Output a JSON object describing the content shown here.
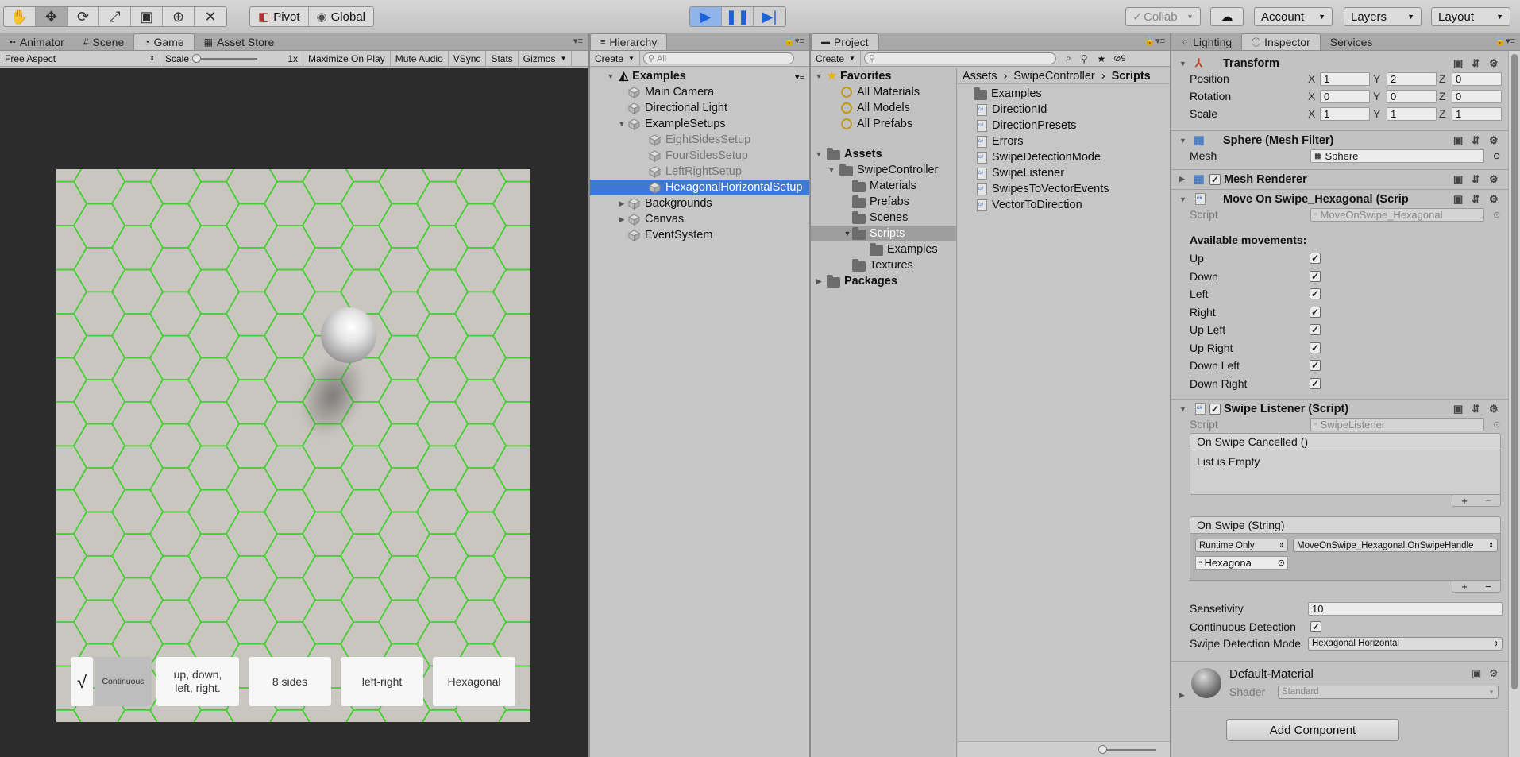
{
  "toolbar": {
    "tools": [
      "hand-tool",
      "move-tool",
      "rotate-tool",
      "scale-tool",
      "rect-tool",
      "transform-tool",
      "custom-tool"
    ],
    "pivot_label": "Pivot",
    "global_label": "Global",
    "collab_label": "Collab",
    "account_label": "Account",
    "layers_label": "Layers",
    "layout_label": "Layout"
  },
  "game_panel": {
    "tabs": [
      "Animator",
      "Scene",
      "Game",
      "Asset Store"
    ],
    "active_tab": "Game",
    "aspect": "Free Aspect",
    "scale_label": "Scale",
    "scale_value": "1x",
    "options": [
      "Maximize On Play",
      "Mute Audio",
      "VSync",
      "Stats",
      "Gizmos"
    ],
    "buttons": {
      "check": "√",
      "continuous": "Continuous",
      "up_down": "up, down,\nleft, right.",
      "eight": "8 sides",
      "left_right": "left-right",
      "hexagonal": "Hexagonal"
    }
  },
  "hierarchy": {
    "tab": "Hierarchy",
    "create_label": "Create",
    "search_placeholder": "All",
    "scene": "Examples",
    "items": [
      {
        "label": "Main Camera"
      },
      {
        "label": "Directional Light"
      },
      {
        "label": "ExampleSetups"
      },
      {
        "label": "EightSidesSetup"
      },
      {
        "label": "FourSidesSetup"
      },
      {
        "label": "LeftRightSetup"
      },
      {
        "label": "HexagonalHorizontalSetup"
      },
      {
        "label": "Backgrounds"
      },
      {
        "label": "Canvas"
      },
      {
        "label": "EventSystem"
      }
    ]
  },
  "project": {
    "tab": "Project",
    "create_label": "Create",
    "badge_count": "9",
    "favorites": "Favorites",
    "fav_items": [
      "All Materials",
      "All Models",
      "All Prefabs"
    ],
    "assets": "Assets",
    "tree": [
      "SwipeController",
      "Materials",
      "Prefabs",
      "Scenes",
      "Scripts",
      "Examples",
      "Textures"
    ],
    "packages": "Packages",
    "breadcrumb": [
      "Assets",
      "SwipeController",
      "Scripts"
    ],
    "files": [
      "Examples",
      "DirectionId",
      "DirectionPresets",
      "Errors",
      "SwipeDetectionMode",
      "SwipeListener",
      "SwipesToVectorEvents",
      "VectorToDirection"
    ]
  },
  "inspector": {
    "tabs": [
      "Lighting",
      "Inspector",
      "Services"
    ],
    "transform": {
      "title": "Transform",
      "position": {
        "label": "Position",
        "x": "1",
        "y": "2",
        "z": "0"
      },
      "rotation": {
        "label": "Rotation",
        "x": "0",
        "y": "0",
        "z": "0"
      },
      "scale": {
        "label": "Scale",
        "x": "1",
        "y": "1",
        "z": "1"
      }
    },
    "mesh_filter": {
      "title": "Sphere (Mesh Filter)",
      "mesh_label": "Mesh",
      "mesh_value": "Sphere"
    },
    "mesh_renderer": {
      "title": "Mesh Renderer"
    },
    "move_on_swipe": {
      "title": "Move On Swipe_Hexagonal (Scrip",
      "script_label": "Script",
      "script_value": "MoveOnSwipe_Hexagonal",
      "available": "Available movements:",
      "movements": [
        "Up",
        "Down",
        "Left",
        "Right",
        "Up Left",
        "Up Right",
        "Down Left",
        "Down Right"
      ]
    },
    "swipe_listener": {
      "title": "Swipe Listener (Script)",
      "script_label": "Script",
      "script_value": "SwipeListener",
      "on_cancel": "On Swipe Cancelled ()",
      "empty": "List is Empty",
      "on_swipe": "On Swipe (String)",
      "runtime": "Runtime Only",
      "handler": "MoveOnSwipe_Hexagonal.OnSwipeHandle",
      "object": "Hexagona",
      "sensitivity_label": "Sensetivity",
      "sensitivity_value": "10",
      "continuous_label": "Continuous Detection",
      "mode_label": "Swipe Detection Mode",
      "mode_value": "Hexagonal Horizontal"
    },
    "material": {
      "name": "Default-Material",
      "shader_label": "Shader",
      "shader_value": "Standard"
    },
    "add_component": "Add Component"
  },
  "colors": {
    "selection": "#3d78d6",
    "hex_grid": "#3fcf2e",
    "play_blue": "#1c63d8"
  }
}
